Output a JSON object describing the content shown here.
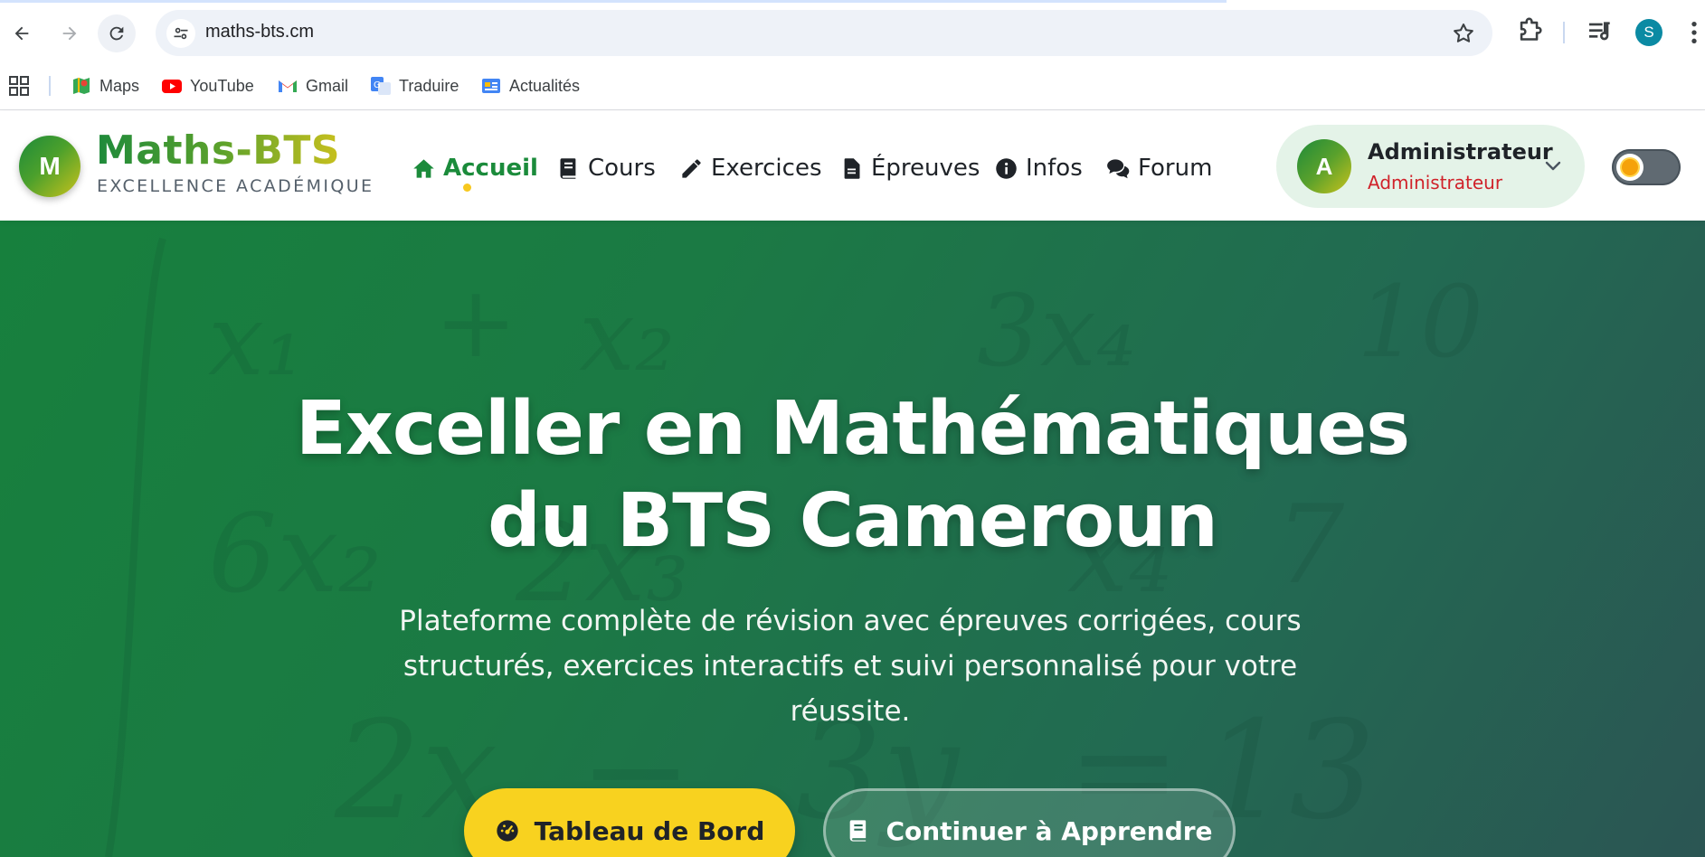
{
  "browser": {
    "url": "maths-bts.cm",
    "profile_initial": "S",
    "bookmarks": [
      {
        "label": "Maps",
        "icon": "maps-icon"
      },
      {
        "label": "YouTube",
        "icon": "youtube-icon"
      },
      {
        "label": "Gmail",
        "icon": "gmail-icon"
      },
      {
        "label": "Traduire",
        "icon": "translate-icon"
      },
      {
        "label": "Actualités",
        "icon": "news-icon"
      }
    ]
  },
  "site": {
    "logo_letter": "M",
    "brand_name": "Maths-BTS",
    "brand_tagline": "EXCELLENCE ACADÉMIQUE",
    "nav": [
      {
        "label": "Accueil",
        "icon": "home-icon",
        "active": true
      },
      {
        "label": "Cours",
        "icon": "book-icon"
      },
      {
        "label": "Exercices",
        "icon": "pencil-icon"
      },
      {
        "label": "Épreuves",
        "icon": "document-icon"
      },
      {
        "label": "Infos",
        "icon": "info-icon"
      },
      {
        "label": "Forum",
        "icon": "comments-icon"
      }
    ],
    "user": {
      "initial": "A",
      "name": "Administrateur",
      "role": "Administrateur"
    },
    "theme_toggle": "sun-icon"
  },
  "hero": {
    "title_line1": "Exceller en Mathématiques",
    "title_line2": "du BTS Cameroun",
    "subtitle_line1": "Plateforme complète de révision avec épreuves corrigées, cours",
    "subtitle_line2": "structurés, exercices interactifs et suivi personnalisé pour votre",
    "subtitle_line3": "réussite.",
    "primary_button": "Tableau de Bord",
    "secondary_button": "Continuer à Apprendre"
  },
  "colors": {
    "brand_green": "#1b8b3b",
    "accent_yellow": "#f8d21f",
    "role_red": "#d0222a"
  }
}
